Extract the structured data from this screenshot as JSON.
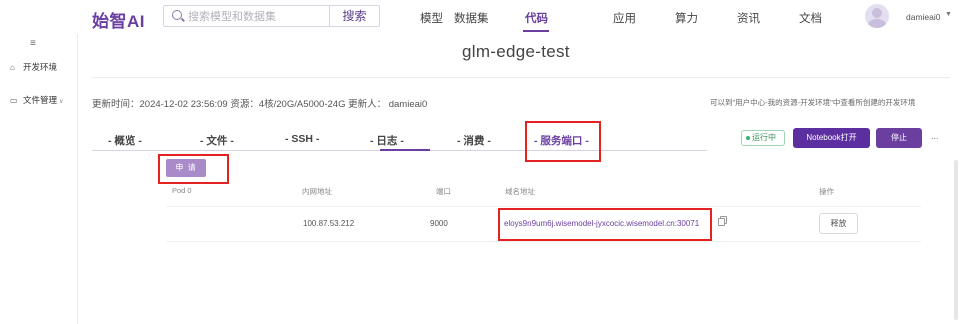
{
  "brand": {
    "logo_text": "始智AI"
  },
  "search": {
    "placeholder": "搜索模型和数据集",
    "button_label": "搜索"
  },
  "nav": {
    "items": [
      {
        "label": "模型"
      },
      {
        "label": "数据集"
      },
      {
        "label": "代码",
        "active": true
      },
      {
        "label": "应用"
      },
      {
        "label": "算力"
      },
      {
        "label": "资讯"
      },
      {
        "label": "文档"
      }
    ]
  },
  "user": {
    "name": "damieai0"
  },
  "sidebar": {
    "toggle": "≡",
    "items": [
      {
        "label": "开发环境",
        "icon": "home-icon"
      },
      {
        "label": "文件管理",
        "icon": "folder-icon"
      }
    ]
  },
  "page": {
    "title": "glm-edge-test",
    "meta": "更新时间：2024-12-02 23:56:09 资源：4核/20G/A5000-24G 更新人：  damieai0",
    "hint": "可以到\"用户中心-我的资源-开发环境\"中查看所创建的开发环境"
  },
  "tabs": [
    {
      "label": "- 概览 -"
    },
    {
      "label": "- 文件 -"
    },
    {
      "label": "- SSH -"
    },
    {
      "label": "- 日志 -"
    },
    {
      "label": "- 消费 -"
    },
    {
      "label": "- 服务端口 -",
      "active": true
    }
  ],
  "actions": {
    "status": "运行中",
    "notebook": "Notebook打开",
    "stop": "停止",
    "more": "..."
  },
  "ports": {
    "apply_label": "申 请",
    "columns": [
      "Pod 0",
      "内网地址",
      "端口",
      "域名地址",
      "操作"
    ],
    "rows": [
      {
        "pod": "",
        "internal_ip": "100.87.53.212",
        "port": "9000",
        "domain": "eloys9n9um6j.wisemodel-jyxcocic.wisemodel.cn:30071",
        "action": "释放"
      }
    ]
  },
  "colors": {
    "accent": "#6b3fa0",
    "highlight": "#e52222",
    "running": "#3ab26a"
  }
}
